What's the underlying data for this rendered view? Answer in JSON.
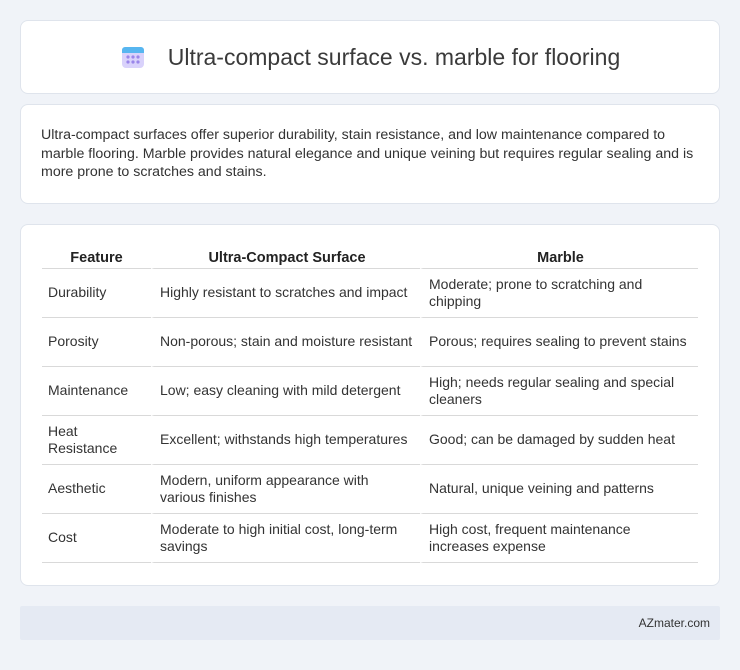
{
  "header": {
    "title": "Ultra-compact surface vs. marble for flooring",
    "icon": "calendar-icon",
    "icon_color": "#8e7de6"
  },
  "summary": {
    "text": "Ultra-compact surfaces offer superior durability, stain resistance, and low maintenance compared to marble flooring. Marble provides natural elegance and unique veining but requires regular sealing and is more prone to scratches and stains."
  },
  "table": {
    "headers": [
      "Feature",
      "Ultra-Compact Surface",
      "Marble"
    ],
    "rows": [
      [
        "Durability",
        "Highly resistant to scratches and impact",
        "Moderate; prone to scratching and chipping"
      ],
      [
        "Porosity",
        "Non-porous; stain and moisture resistant",
        "Porous; requires sealing to prevent stains"
      ],
      [
        "Maintenance",
        "Low; easy cleaning with mild detergent",
        "High; needs regular sealing and special cleaners"
      ],
      [
        "Heat Resistance",
        "Excellent; withstands high temperatures",
        "Good; can be damaged by sudden heat"
      ],
      [
        "Aesthetic",
        "Modern, uniform appearance with various finishes",
        "Natural, unique veining and patterns"
      ],
      [
        "Cost",
        "Moderate to high initial cost, long-term savings",
        "High cost, frequent maintenance increases expense"
      ]
    ]
  },
  "footer": {
    "brand": "AZmater.com"
  }
}
